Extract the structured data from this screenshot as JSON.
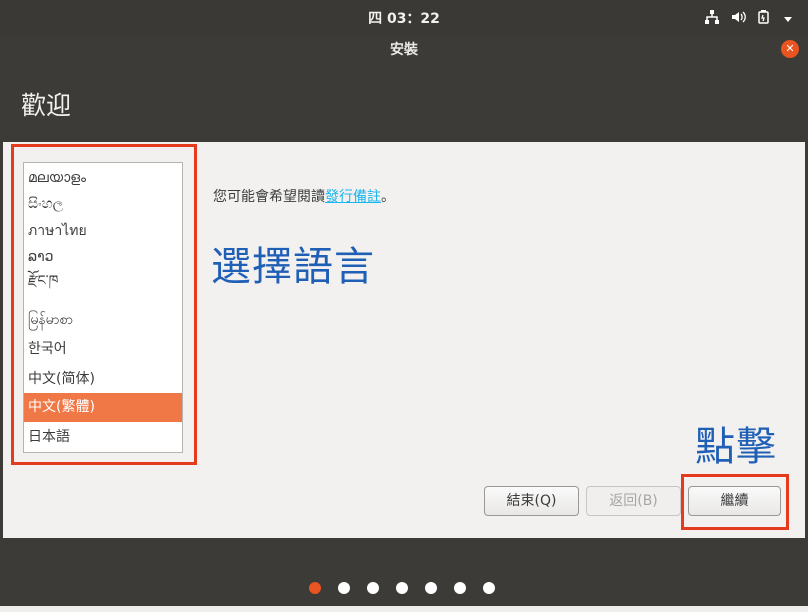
{
  "system_bar": {
    "clock": "四 03：22",
    "icons": [
      "network-icon",
      "volume-icon",
      "power-icon",
      "menu-arrow-icon"
    ]
  },
  "window": {
    "title": "安裝",
    "page_title": "歡迎"
  },
  "languages": {
    "items": [
      {
        "label": "മലയാളം"
      },
      {
        "label": "සිංහල"
      },
      {
        "label": "ภาษาไทย"
      },
      {
        "label": "ລາວ"
      },
      {
        "label": "རྫོང་ཁ"
      },
      {
        "label": "မြန်မာစာ"
      },
      {
        "label": "한국어"
      },
      {
        "label": "中文(简体)"
      },
      {
        "label": "中文(繁體)"
      },
      {
        "label": "日本語"
      }
    ],
    "selected": "中文(繁體)"
  },
  "release_note": {
    "prefix": "您可能會希望閱讀",
    "link": "發行備註",
    "suffix": "。"
  },
  "annotations": {
    "select_language": "選擇語言",
    "click": "點擊"
  },
  "buttons": {
    "quit": "結束(Q)",
    "back": "返回(B)",
    "continue": "繼續"
  },
  "progress": {
    "total_steps": 7,
    "current_step": 1
  },
  "colors": {
    "accent": "#e95420",
    "selection": "#f07746",
    "annotation_blue": "#1f5fb5",
    "annotation_red": "#e53a1e"
  }
}
